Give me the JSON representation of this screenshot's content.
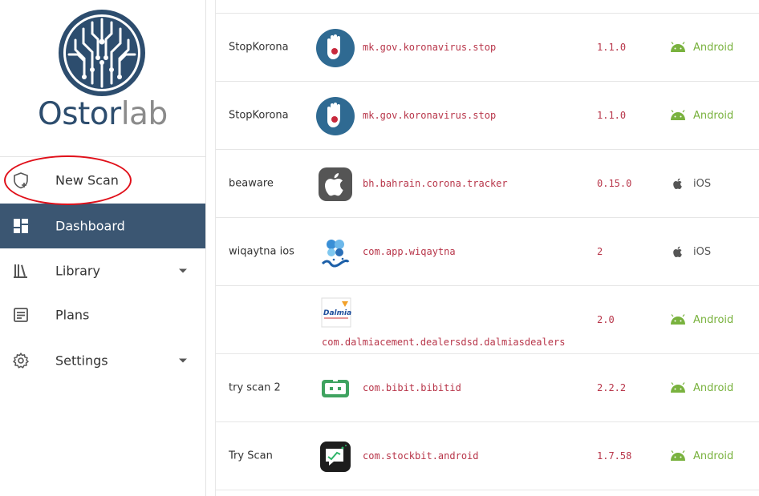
{
  "brand": {
    "logo_part1": "Ostor",
    "logo_part2": "lab"
  },
  "sidebar": {
    "items": [
      {
        "label": "New Scan",
        "icon": "shield-plus-icon"
      },
      {
        "label": "Dashboard",
        "icon": "dashboard-icon",
        "active": true
      },
      {
        "label": "Library",
        "icon": "library-icon",
        "has_dropdown": true
      },
      {
        "label": "Plans",
        "icon": "plans-icon"
      },
      {
        "label": "Settings",
        "icon": "gear-icon",
        "has_dropdown": true
      }
    ]
  },
  "scans": [
    {
      "name": "StopKorona",
      "package": "mk.gov.koronavirus.stop",
      "version": "1.1.0",
      "platform": "Android",
      "icon": "stopkorona-hand-icon"
    },
    {
      "name": "StopKorona",
      "package": "mk.gov.koronavirus.stop",
      "version": "1.1.0",
      "platform": "Android",
      "icon": "stopkorona-hand-icon"
    },
    {
      "name": "beaware",
      "package": "bh.bahrain.corona.tracker",
      "version": "0.15.0",
      "platform": "iOS",
      "icon": "apple-icon"
    },
    {
      "name": "wiqaytna ios",
      "package": "com.app.wiqaytna",
      "version": "2",
      "platform": "iOS",
      "icon": "wiqaytna-icon"
    },
    {
      "name": "",
      "package": "com.dalmiacement.dealersdsd.dalmiasdealers",
      "version": "2.0",
      "platform": "Android",
      "icon": "dalmia-icon",
      "icon_text": "Dalmia"
    },
    {
      "name": "try scan 2",
      "package": "com.bibit.bibitid",
      "version": "2.2.2",
      "platform": "Android",
      "icon": "bibit-icon"
    },
    {
      "name": "Try Scan",
      "package": "com.stockbit.android",
      "version": "1.7.58",
      "platform": "Android",
      "icon": "stockbit-icon"
    }
  ],
  "colors": {
    "sidebar_active": "#3b5672",
    "brand_dark": "#2d4d6e",
    "package_text": "#b8364a",
    "android_green": "#79b23e",
    "highlight_red": "#e0101a"
  }
}
